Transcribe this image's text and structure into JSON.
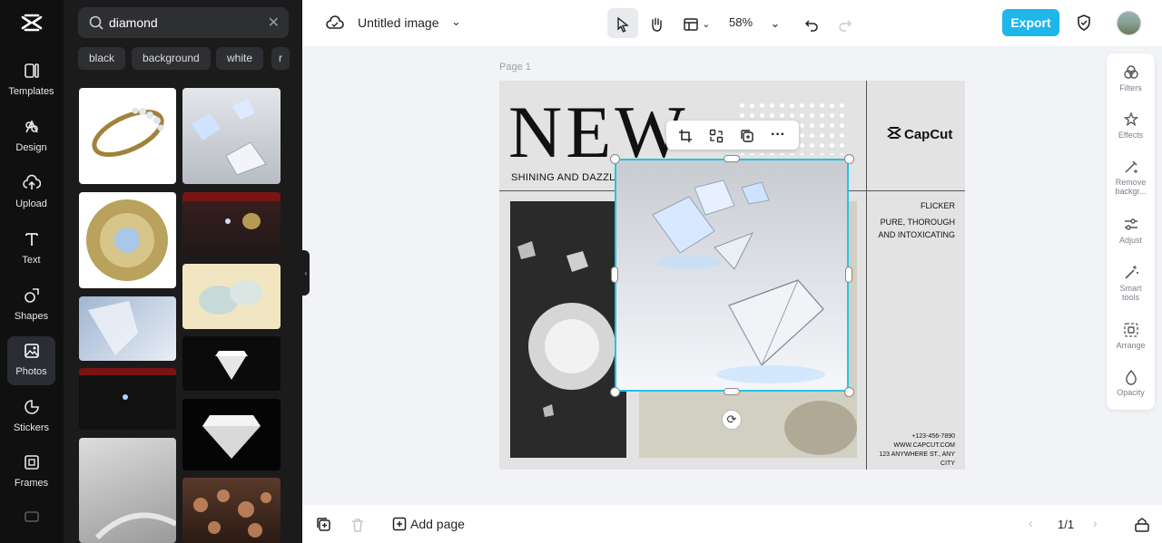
{
  "rail": {
    "items": [
      {
        "label": "Templates",
        "icon": "templates-icon"
      },
      {
        "label": "Design",
        "icon": "design-icon"
      },
      {
        "label": "Upload",
        "icon": "upload-icon"
      },
      {
        "label": "Text",
        "icon": "text-icon"
      },
      {
        "label": "Shapes",
        "icon": "shapes-icon"
      },
      {
        "label": "Photos",
        "icon": "photos-icon",
        "active": true
      },
      {
        "label": "Stickers",
        "icon": "stickers-icon"
      },
      {
        "label": "Frames",
        "icon": "frames-icon"
      }
    ]
  },
  "search": {
    "value": "diamond",
    "placeholder": "Search"
  },
  "chips": [
    "black",
    "background",
    "white",
    "r"
  ],
  "topbar": {
    "doc_title": "Untitled image",
    "zoom": "58%",
    "export_label": "Export"
  },
  "canvas": {
    "page_label": "Page 1",
    "headline": "NEW",
    "subheadline": "SHINING AND DAZZLI",
    "brand": "CapCut",
    "flicker": "FLICKER",
    "tagline_1": "PURE, THOROUGH",
    "tagline_2": "AND INTOXICATING",
    "phone": "+123-456-7890",
    "web": "WWW.CAPCUT.COM",
    "address": "123 ANYWHERE ST., ANY CITY"
  },
  "rtools": [
    {
      "label": "Filters"
    },
    {
      "label": "Effects"
    },
    {
      "label": "Remove backgr..."
    },
    {
      "label": "Adjust"
    },
    {
      "label": "Smart tools"
    },
    {
      "label": "Arrange"
    },
    {
      "label": "Opacity"
    }
  ],
  "bottombar": {
    "add_page": "Add page",
    "pager": "1/1"
  },
  "colors": {
    "accent": "#1fb6ea",
    "selection": "#22c3e6",
    "rail_bg": "#101010",
    "panel_bg": "#1b1b1b"
  }
}
